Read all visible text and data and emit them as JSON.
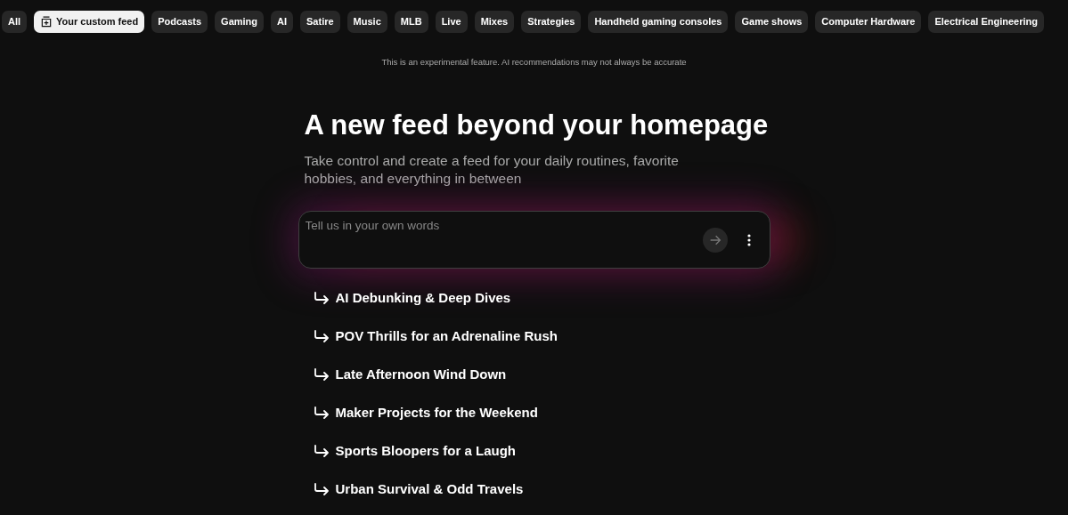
{
  "chips": [
    {
      "label": "All",
      "kind": "topic",
      "selected": false
    },
    {
      "label": "Your custom feed",
      "kind": "custom",
      "selected": true
    },
    {
      "label": "Podcasts",
      "kind": "topic",
      "selected": false
    },
    {
      "label": "Gaming",
      "kind": "topic",
      "selected": false
    },
    {
      "label": "AI",
      "kind": "topic",
      "selected": false
    },
    {
      "label": "Satire",
      "kind": "topic",
      "selected": false
    },
    {
      "label": "Music",
      "kind": "topic",
      "selected": false
    },
    {
      "label": "MLB",
      "kind": "topic",
      "selected": false
    },
    {
      "label": "Live",
      "kind": "topic",
      "selected": false
    },
    {
      "label": "Mixes",
      "kind": "topic",
      "selected": false
    },
    {
      "label": "Strategies",
      "kind": "topic",
      "selected": false
    },
    {
      "label": "Handheld gaming consoles",
      "kind": "topic",
      "selected": false
    },
    {
      "label": "Game shows",
      "kind": "topic",
      "selected": false
    },
    {
      "label": "Computer Hardware",
      "kind": "topic",
      "selected": false
    },
    {
      "label": "Electrical Engineering",
      "kind": "topic",
      "selected": false
    }
  ],
  "notice": "This is an experimental feature. AI recommendations may not always be accurate",
  "heading": "A new feed beyond your homepage",
  "subheading": "Take control and create a feed for your daily routines, favorite hobbies, and everything in between",
  "prompt": {
    "placeholder": "Tell us in your own words"
  },
  "suggestions": [
    "AI Debunking & Deep Dives",
    "POV Thrills for an Adrenaline Rush",
    "Late Afternoon Wind Down",
    "Maker Projects for the Weekend",
    "Sports Bloopers for a Laugh",
    "Urban Survival & Odd Travels"
  ]
}
